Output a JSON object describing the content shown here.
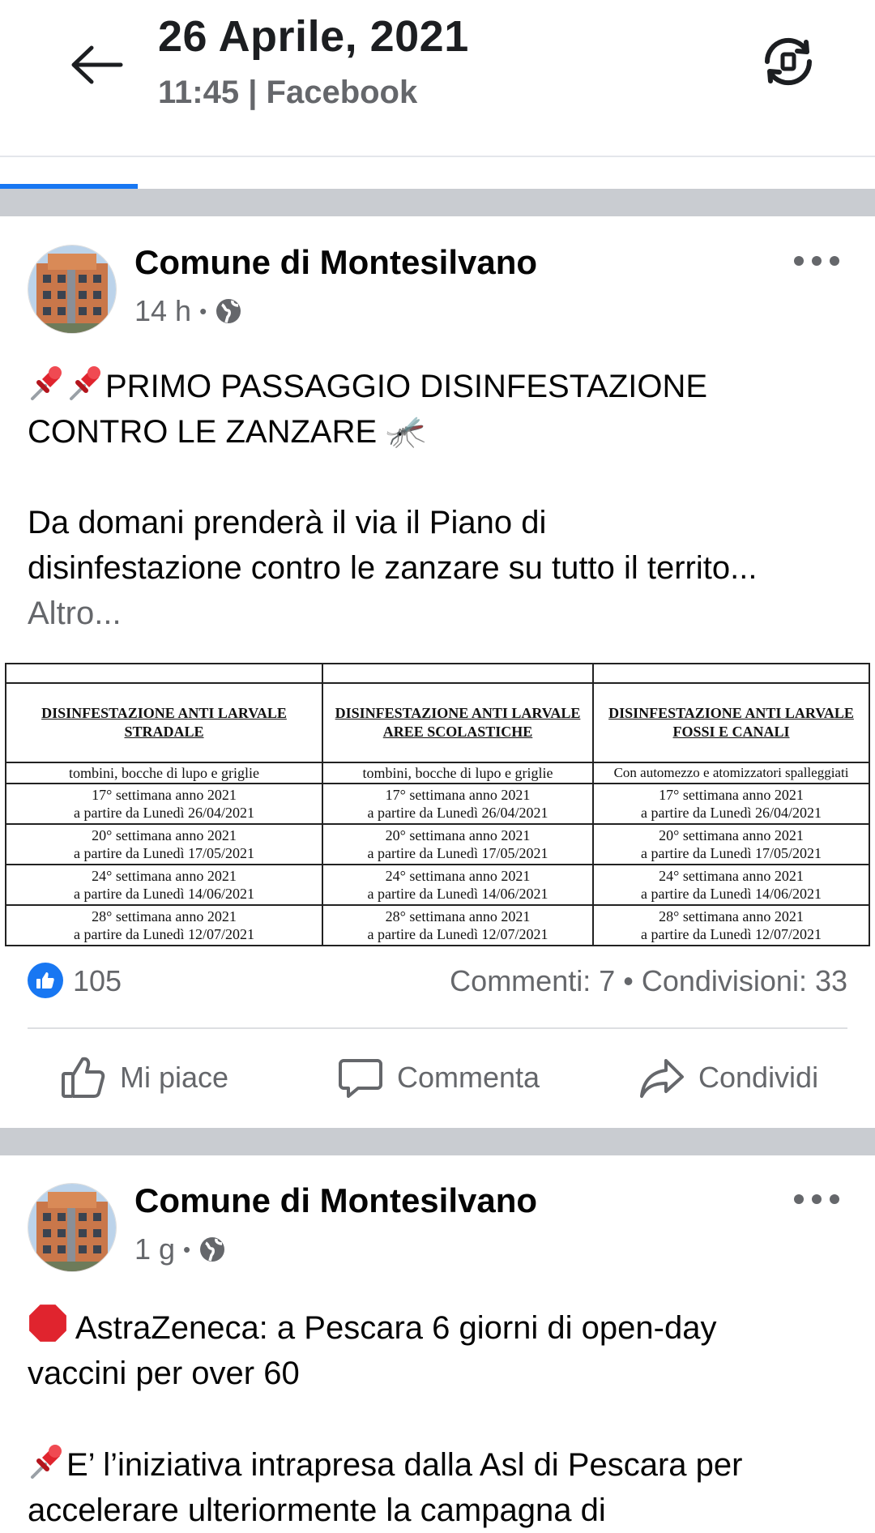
{
  "header": {
    "date": "26 Aprile, 2021",
    "subtitle": "11:45 | Facebook",
    "back_icon": "arrow-left-icon",
    "rotate_icon": "rotate-screen-icon"
  },
  "posts": [
    {
      "author": "Comune di Montesilvano",
      "time": "14 h",
      "meta_sep": "•",
      "title_line1": "PRIMO PASSAGGIO DISINFESTAZIONE",
      "title_line2": "CONTRO LE ZANZARE",
      "mosquito": "🦟",
      "body_line1": "Da domani prenderà il via il Piano di",
      "body_line2": "disinfestazione contro le zanzare su tutto il territo...",
      "more_link": "Altro...",
      "table": {
        "headers": [
          [
            "DISINFESTAZIONE ANTI LARVALE",
            "STRADALE"
          ],
          [
            "DISINFESTAZIONE ANTI LARVALE",
            "AREE SCOLASTICHE"
          ],
          [
            "DISINFESTAZIONE ANTI LARVALE",
            "FOSSI E CANALI"
          ]
        ],
        "notes": [
          "tombini, bocche di lupo e griglie",
          "tombini, bocche di lupo e griglie",
          "Con automezzo e atomizzatori spalleggiati"
        ],
        "weeks": [
          [
            "17° settimana anno 2021",
            "a partire da Lunedì 26/04/2021"
          ],
          [
            "20° settimana anno 2021",
            "a partire da Lunedì 17/05/2021"
          ],
          [
            "24° settimana anno 2021",
            "a partire da Lunedì 14/06/2021"
          ],
          [
            "28° settimana anno 2021",
            "a partire da Lunedì 12/07/2021"
          ]
        ]
      },
      "likes": "105",
      "comments_shares": "Commenti: 7 • Condivisioni: 33",
      "actions": {
        "like": "Mi piace",
        "comment": "Commenta",
        "share": "Condividi"
      }
    },
    {
      "author": "Comune di Montesilvano",
      "time": "1 g",
      "meta_sep": "•",
      "line1": "AstraZeneca: a Pescara 6 giorni di open-day",
      "line2": "vaccini per over 60",
      "line3": "E’ l’iniziativa intrapresa dalla Asl di Pescara per",
      "line4": "accelerare ulteriormente la campagna di"
    }
  ],
  "colors": {
    "accent": "#1877f2",
    "separator": "#c9ccd1",
    "muted": "#65676b"
  }
}
